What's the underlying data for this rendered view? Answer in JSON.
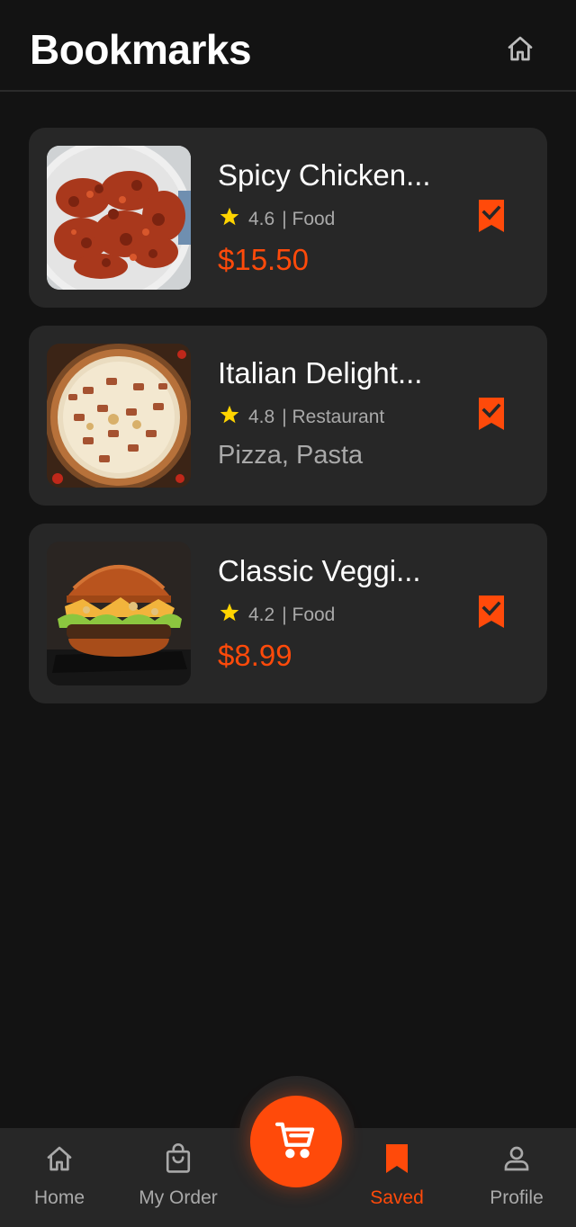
{
  "header": {
    "title": "Bookmarks",
    "home_icon": "home-icon"
  },
  "colors": {
    "background": "#131313",
    "card": "#272727",
    "accent": "#ff4a0a",
    "muted_text": "#a9a9a9",
    "star": "#ffd400"
  },
  "bookmarks": [
    {
      "title": "Spicy Chicken...",
      "rating": "4.6",
      "category": "| Food",
      "price": "$15.50",
      "image": "fried-chicken-image"
    },
    {
      "title": "Italian Delight...",
      "rating": "4.8",
      "category": "| Restaurant",
      "subtitle": "Pizza, Pasta",
      "image": "pizza-image"
    },
    {
      "title": "Classic Veggi...",
      "rating": "4.2",
      "category": "| Food",
      "price": "$8.99",
      "image": "burger-image"
    }
  ],
  "nav": {
    "items": [
      {
        "label": "Home",
        "icon": "home-icon"
      },
      {
        "label": "My Order",
        "icon": "shopping-bag-icon"
      },
      {
        "label": "Saved",
        "icon": "bookmark-icon",
        "active": true
      },
      {
        "label": "Profile",
        "icon": "person-icon"
      }
    ],
    "center_button_icon": "cart-icon"
  }
}
